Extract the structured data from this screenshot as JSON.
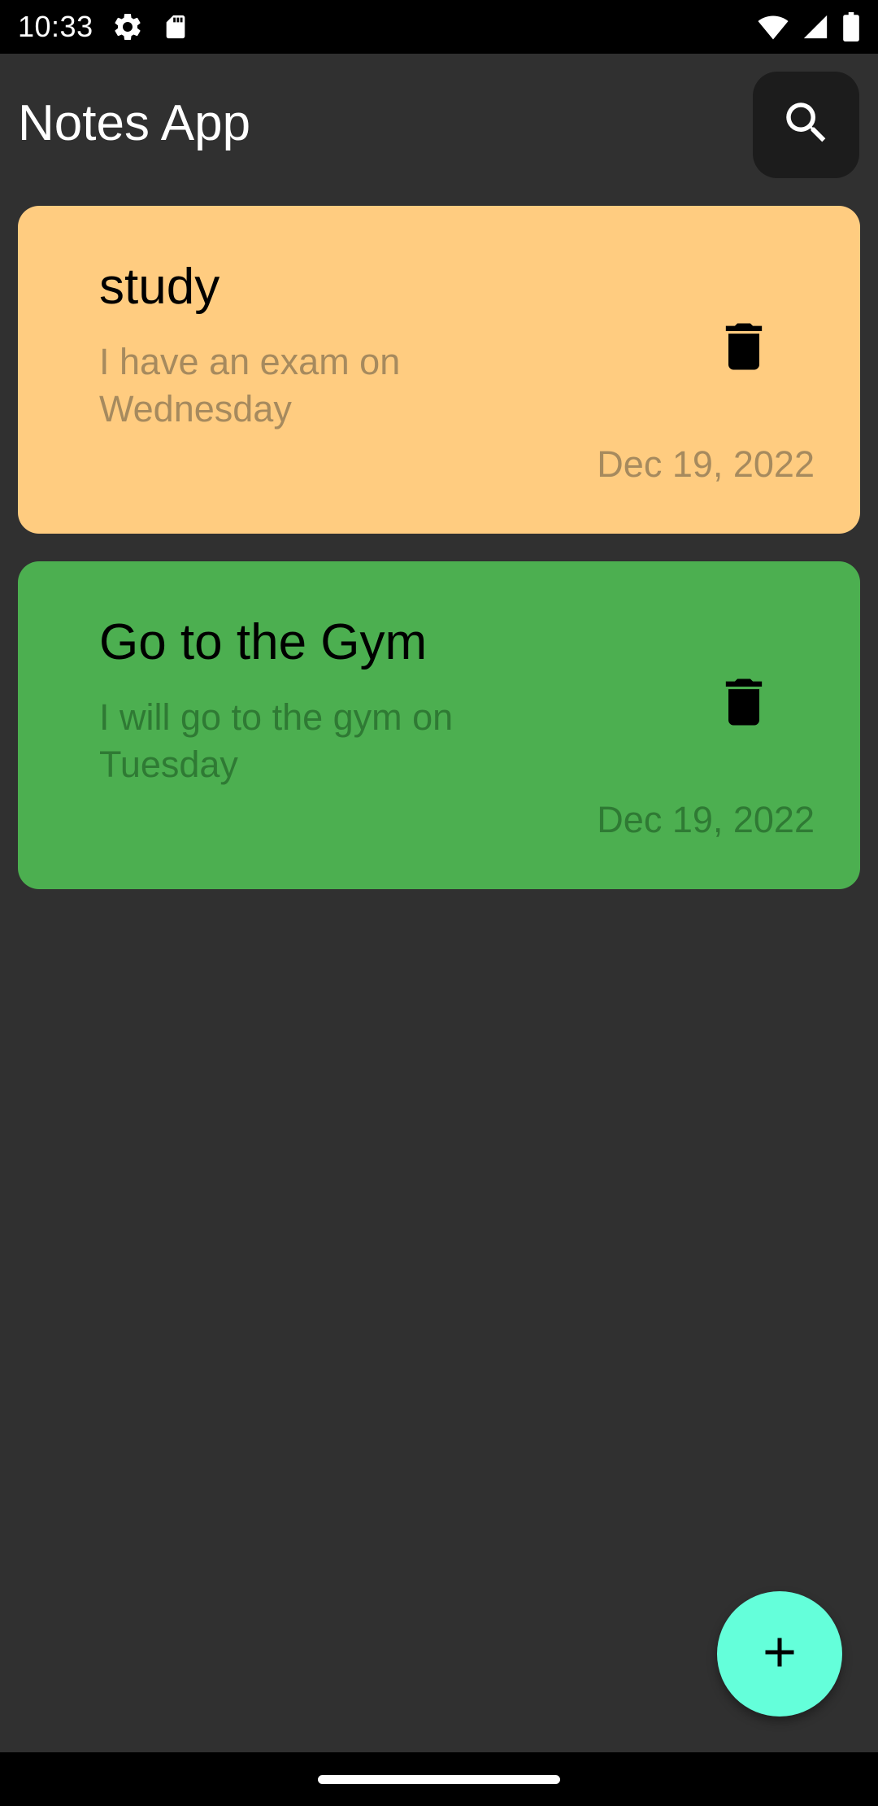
{
  "status_bar": {
    "time": "10:33",
    "icons": [
      "settings-icon",
      "sd-card-icon",
      "wifi-icon",
      "signal-icon",
      "battery-icon"
    ]
  },
  "app_bar": {
    "title": "Notes App",
    "search_icon": "search-icon"
  },
  "notes": [
    {
      "title": "study",
      "body": "I have an exam on Wednesday",
      "date": "Dec 19, 2022",
      "color": "#FFCC80",
      "body_color": "#A68A5E",
      "date_color": "#A68A5E"
    },
    {
      "title": "Go to the Gym",
      "body": "I will go to the gym on Tuesday",
      "date": "Dec 19, 2022",
      "color": "#4CAF50",
      "body_color": "#2F7A34",
      "date_color": "#2F7A34"
    }
  ],
  "fab": {
    "icon": "plus-icon",
    "color": "#64FFDA"
  },
  "colors": {
    "background": "#303030",
    "search_button_bg": "#1C1C1C"
  }
}
